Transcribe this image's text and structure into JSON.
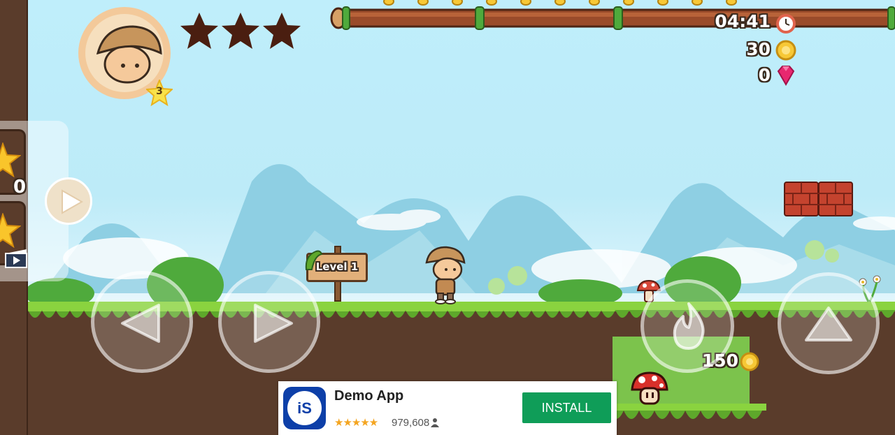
{
  "hud": {
    "player_level": "3",
    "stars_collected": 0,
    "stars_total": 3,
    "timer": "04:41",
    "coins": "30",
    "gems": "0"
  },
  "side_panel": {
    "counter": "0"
  },
  "world": {
    "sign_text": "Level 1",
    "coin_bonus": "150"
  },
  "ad": {
    "app_name": "Demo App",
    "rating_stars": 4.5,
    "review_count": "979,608",
    "install_label": "INSTALL",
    "icon_text": "iS",
    "colors": {
      "install_bg": "#0f9d58",
      "icon_bg": "#0d3fa8",
      "star": "#f4a521"
    }
  },
  "colors": {
    "sky": "#bfeefb",
    "grass": "#6cc235",
    "dirt": "#5a3c2b",
    "brick": "#c4432e",
    "coin": "#f7c836",
    "gem": "#e8276f",
    "star_empty": "#4a1e10"
  }
}
